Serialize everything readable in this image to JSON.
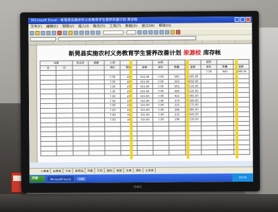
{
  "window": {
    "title": "Microsoft Excel - 新晃县实施农村义务教育学生营养改善计划 库存帐"
  },
  "menu": {
    "items": [
      "文件(F)",
      "编辑(E)",
      "视图(V)",
      "插入(I)",
      "格式(O)",
      "工具(T)",
      "数据(D)",
      "窗口(W)",
      "帮助(H)"
    ]
  },
  "sheet": {
    "title_main": "新晃县实施农村义务教育学生营养改善计划",
    "title_red": "汞源校",
    "title_tail": "库存帐",
    "row1": [
      "日期",
      "凭证号",
      "摘要",
      "入库",
      "",
      "",
      "出库",
      "",
      "",
      "结存",
      "",
      ""
    ],
    "row2": [
      "月",
      "日",
      "",
      "",
      "单价",
      "数量",
      "金额",
      "单价",
      "数量",
      "金额",
      "单价",
      "数量",
      "金额"
    ],
    "rows": [
      [
        "7.00",
        "640",
        "4480.00"
      ],
      [
        "",
        "",
        "",
        "7.00",
        "45",
        "315.00",
        "7.00",
        "595",
        "4165.00"
      ],
      [
        "",
        "",
        "",
        "7.00",
        "45",
        "315.00",
        "7.00",
        "550",
        "3850.00"
      ],
      [
        "",
        "",
        "",
        "7.00",
        "45",
        "315.00",
        "7.00",
        "505",
        "3535.00"
      ],
      [
        "",
        "",
        "",
        "7.00",
        "45",
        "315.00",
        "7.00",
        "460",
        "3220.00"
      ],
      [
        "",
        "",
        "",
        "7.00",
        "45",
        "315.00",
        "7.00",
        "415",
        "2905.00"
      ],
      [
        "",
        "",
        "",
        "7.00",
        "45",
        "315.00",
        "7.00",
        "370",
        "2590.00"
      ],
      [
        "",
        "",
        "",
        "7.00",
        "45",
        "315.00",
        "7.00",
        "325",
        "2275.00"
      ],
      [
        "",
        "",
        "",
        "7.00",
        "45",
        "315.00",
        "7.00",
        "280",
        "1960.00"
      ],
      [
        "",
        "",
        "",
        "7.00",
        "45",
        "315.00",
        "7.00",
        "235",
        "1645.00"
      ],
      [
        "",
        "",
        "",
        "7.00",
        "45",
        "315.00",
        "7.00",
        "190",
        "1330.00"
      ]
    ]
  },
  "tabs": [
    "入库单",
    "出库单",
    "大米",
    "食用油",
    "鸡蛋",
    "牛奶",
    "猪肉",
    "蔬菜",
    "水果",
    "调料",
    "汇总表"
  ],
  "taskbar": {
    "start": "开始",
    "tasks": [
      "Microsoft Excel",
      "文档"
    ],
    "clock": "10:24"
  },
  "monitor": {
    "brand": "nec"
  }
}
